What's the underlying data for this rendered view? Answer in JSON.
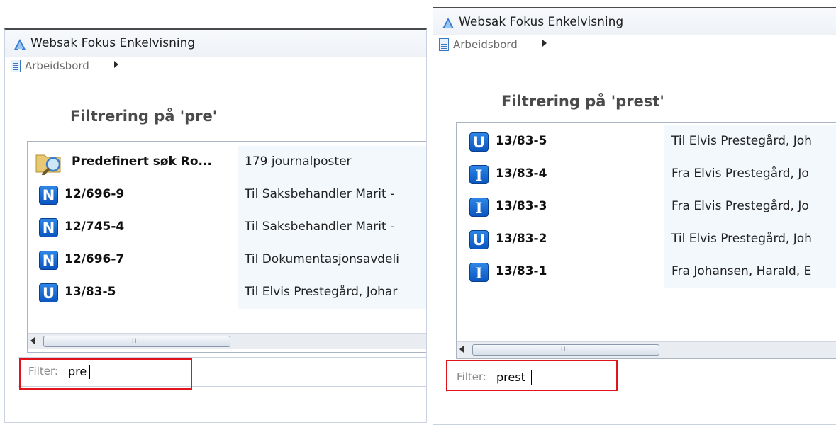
{
  "colors": {
    "badge": "#0b56c0",
    "highlight": "#e0141a",
    "rowbg": "#f3f8fd"
  },
  "left": {
    "title": "Websak Fokus Enkelvisning",
    "crumb": "Arbeidsbord",
    "heading": "Filtrering på 'pre'",
    "rows": [
      {
        "icon": "search-folder-icon",
        "id": "Predefinert søk Ro...",
        "text": "179 journalposter"
      },
      {
        "icon": "N",
        "id": "12/696-9",
        "text": "Til Saksbehandler Marit -"
      },
      {
        "icon": "N",
        "id": "12/745-4",
        "text": "Til Saksbehandler Marit -"
      },
      {
        "icon": "N",
        "id": "12/696-7",
        "text": "Til Dokumentasjonsavdeli"
      },
      {
        "icon": "U",
        "id": "13/83-5",
        "text": "Til Elvis Prestegård, Johar"
      }
    ],
    "scroll_grip": "III",
    "filter_label": "Filter:",
    "filter_value": "pre"
  },
  "right": {
    "title": "Websak Fokus Enkelvisning",
    "crumb": "Arbeidsbord",
    "heading": "Filtrering på 'prest'",
    "rows": [
      {
        "icon": "U",
        "id": "13/83-5",
        "text": "Til Elvis Prestegård, Joh"
      },
      {
        "icon": "I",
        "id": "13/83-4",
        "text": "Fra Elvis Prestegård, Jo"
      },
      {
        "icon": "I",
        "id": "13/83-3",
        "text": "Fra Elvis Prestegård, Jo"
      },
      {
        "icon": "U",
        "id": "13/83-2",
        "text": "Til Elvis Prestegård, Joh"
      },
      {
        "icon": "I",
        "id": "13/83-1",
        "text": "Fra Johansen, Harald, E"
      }
    ],
    "scroll_grip": "III",
    "filter_label": "Filter:",
    "filter_value": "prest"
  }
}
